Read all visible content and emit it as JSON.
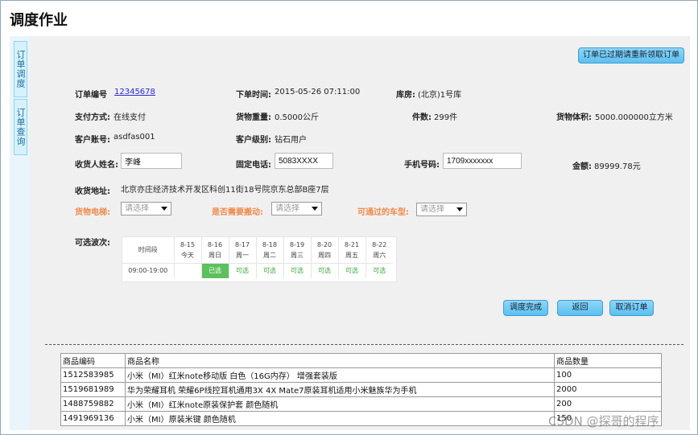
{
  "page": {
    "title": "调度作业"
  },
  "sidebar": {
    "tabs": [
      {
        "label": "订单调度"
      },
      {
        "label": "订单查询"
      }
    ]
  },
  "header": {
    "reclaim_button": "订单已过期请重新领取订单"
  },
  "order": {
    "number_label": "订单编号",
    "number_value": "12345678",
    "time_label": "下单时间:",
    "time_value": "2015-05-26 07:11:00",
    "warehouse_label": "库房:",
    "warehouse_value": "(北京)1号库",
    "payment_label": "支付方式:",
    "payment_value": "在线支付",
    "weight_label": "货物重量:",
    "weight_value": "0.5000公斤",
    "pieces_label": "件数:",
    "pieces_value": "299件",
    "volume_label": "货物体积:",
    "volume_value": "5000.000000立方米",
    "account_label": "客户账号:",
    "account_value": "asdfas001",
    "level_label": "客户级别:",
    "level_value": "钻石用户",
    "name_label": "收货人姓名:",
    "name_value": "李峰",
    "phone_label": "固定电话:",
    "phone_value": "5083XXXX",
    "mobile_label": "手机号码:",
    "mobile_value": "1709xxxxxxx",
    "amount_label": "金额:",
    "amount_value": "89999.78元",
    "address_label": "收货地址:",
    "address_value": "北京亦庄经济技术开发区科创11街18号院京东总部B座7层"
  },
  "options": {
    "elevator_label": "货物电梯:",
    "carry_label": "是否需要搬动:",
    "vehicle_label": "可通过的车型:",
    "select_placeholder": "请选择"
  },
  "waves": {
    "label": "可选波次:",
    "period_header": "时间段",
    "days": [
      {
        "date": "8-15",
        "day": "今天"
      },
      {
        "date": "8-16",
        "day": "周日"
      },
      {
        "date": "8-17",
        "day": "周一"
      },
      {
        "date": "8-18",
        "day": "周二"
      },
      {
        "date": "8-19",
        "day": "周三"
      },
      {
        "date": "8-20",
        "day": "周四"
      },
      {
        "date": "8-21",
        "day": "周五"
      },
      {
        "date": "8-22",
        "day": "周六"
      }
    ],
    "slot": "09:00-19:00",
    "cells": [
      "",
      "已选",
      "可选",
      "可选",
      "可选",
      "可选",
      "可选",
      "可选"
    ]
  },
  "actions": {
    "complete": "调度完成",
    "back": "返回",
    "cancel": "取消订单"
  },
  "products": {
    "headers": [
      "商品编码",
      "商品名称",
      "商品数量"
    ],
    "rows": [
      [
        "1512583985",
        "小米（MI）红米note移动版 白色（16G内存） 增强套装版",
        "100"
      ],
      [
        "1519681989",
        "华为荣耀耳机 荣耀6P线控耳机通用3X 4X Mate7原装耳机适用小米魅族华为手机",
        "2000"
      ],
      [
        "1488759882",
        "小米（MI）红米note原装保护套 颜色随机",
        "200"
      ],
      [
        "1491969136",
        "小米（MI）原装米键 颜色随机",
        "150"
      ]
    ]
  },
  "watermark": "CSDN @探哥的程序",
  "colors": {
    "accent": "#5cbfef",
    "selected": "#5cc05c",
    "available": "#3fa93f",
    "warning_label": "#f08a4b"
  }
}
